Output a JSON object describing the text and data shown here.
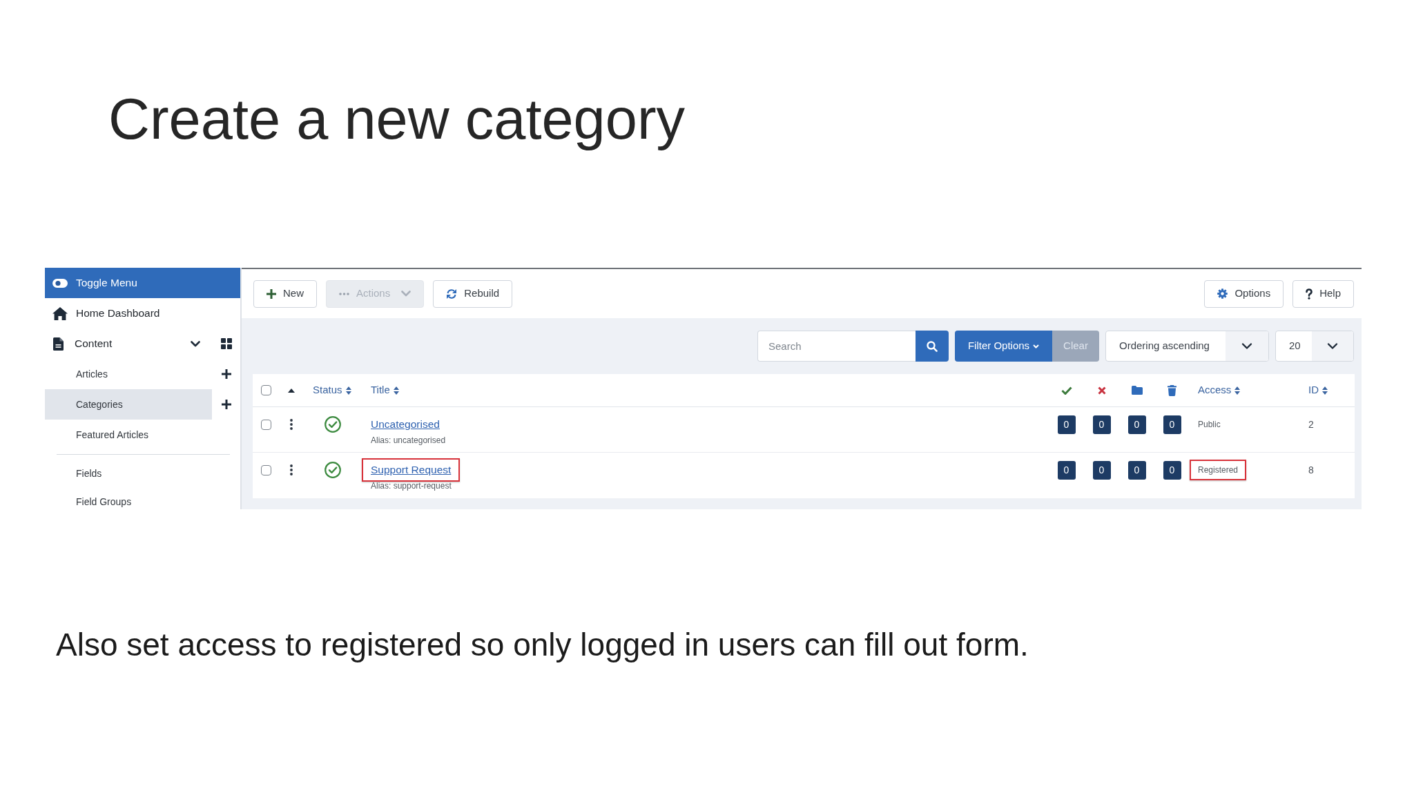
{
  "slide": {
    "title": "Create a new category",
    "caption": "Also set access to registered so only logged in users can fill out form."
  },
  "sidebar": {
    "toggle": {
      "label": "Toggle Menu"
    },
    "items": [
      {
        "kind": "home",
        "label": "Home Dashboard",
        "selected": false
      },
      {
        "kind": "section",
        "label": "Content",
        "expanded": true,
        "children": [
          {
            "kind": "link",
            "label": "Articles",
            "selected": false,
            "add": true
          },
          {
            "kind": "link",
            "label": "Categories",
            "selected": true,
            "add": true
          },
          {
            "kind": "link",
            "label": "Featured Articles",
            "selected": false,
            "add": false
          },
          {
            "kind": "divider"
          },
          {
            "kind": "link",
            "label": "Fields",
            "selected": false,
            "add": false
          },
          {
            "kind": "link",
            "label": "Field Groups",
            "selected": false,
            "add": false
          }
        ]
      }
    ]
  },
  "toolbar": {
    "left": [
      {
        "kind": "new",
        "label": "New",
        "disabled": false
      },
      {
        "kind": "actions",
        "label": "Actions",
        "disabled": true
      },
      {
        "kind": "rebuild",
        "label": "Rebuild",
        "disabled": false
      }
    ],
    "right": [
      {
        "kind": "options",
        "label": "Options"
      },
      {
        "kind": "help",
        "label": "Help"
      }
    ]
  },
  "filters": {
    "search": {
      "placeholder": "Search"
    },
    "filter_options": "Filter Options",
    "clear": "Clear",
    "ordering": "Ordering ascending",
    "limit": "20"
  },
  "table": {
    "columns": [
      {
        "kind": "checkbox",
        "checked": false
      },
      {
        "kind": "ordering"
      },
      {
        "kind": "status",
        "label": "Status",
        "sortable": true
      },
      {
        "kind": "title",
        "label": "Title",
        "sortable": true
      },
      {
        "kind": "published"
      },
      {
        "kind": "unpublished"
      },
      {
        "kind": "archived"
      },
      {
        "kind": "trashed"
      },
      {
        "kind": "access",
        "label": "Access",
        "sortable": true
      },
      {
        "kind": "id",
        "label": "ID",
        "sortable": true
      }
    ],
    "rows": [
      {
        "checked": false,
        "published": true,
        "title": "Uncategorised",
        "title_highlighted": false,
        "alias": "Alias: uncategorised",
        "counts": [
          "0",
          "0",
          "0",
          "0"
        ],
        "access": "Public",
        "access_highlighted": false,
        "id": "2"
      },
      {
        "checked": false,
        "published": true,
        "title": "Support Request",
        "title_highlighted": true,
        "alias": "Alias: support-request",
        "counts": [
          "0",
          "0",
          "0",
          "0"
        ],
        "access": "Registered",
        "access_highlighted": true,
        "id": "8"
      }
    ]
  }
}
